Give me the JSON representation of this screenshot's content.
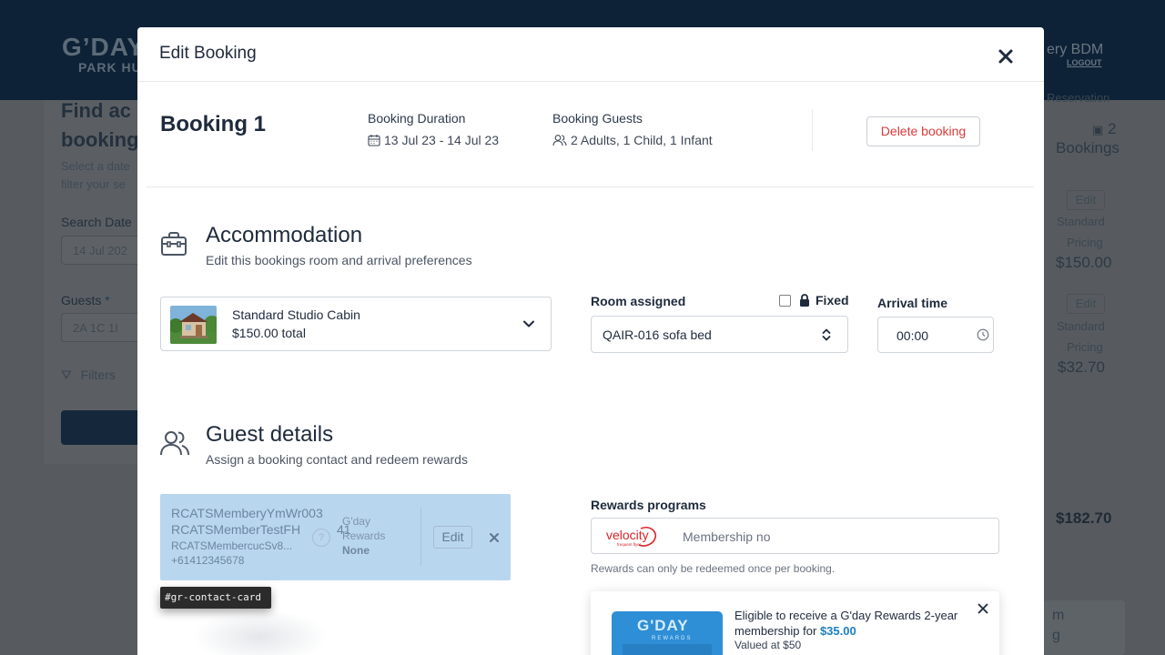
{
  "background": {
    "logo_line1": "G’DAY",
    "logo_line2": "PARK HU",
    "user_name": "ery BDM",
    "logout": "LOGOUT",
    "heading": "Find ac\nbooking",
    "sub": "Select a date\nfilter your se",
    "search_dates_label": "Search Date",
    "search_dates_value": "14 Jul 202",
    "guests_label": "Guests",
    "guests_required": "*",
    "guests_value": "2A 1C 1I",
    "filters_label": "Filters",
    "reservation_label": "Reservation",
    "bookings_count": "2",
    "bookings_label": "Bookings",
    "edit_label": "Edit",
    "standard": "Standard",
    "pricing": "Pricing",
    "price1": "$150.00",
    "price2": "$32.70",
    "total": "$182.70",
    "card_m": "m",
    "card_g": "g"
  },
  "modal": {
    "title": "Edit Booking",
    "booking_title": "Booking 1",
    "duration_label": "Booking Duration",
    "duration_value": "13 Jul 23 - 14 Jul 23",
    "guests_label": "Booking Guests",
    "guests_value": "2 Adults, 1 Child, 1 Infant",
    "delete_label": "Delete booking"
  },
  "accommodation": {
    "title": "Accommodation",
    "subtitle": "Edit this bookings room and arrival preferences",
    "room_name": "Standard Studio Cabin",
    "room_price": "$150.00 total",
    "room_assigned_label": "Room assigned",
    "fixed_label": "Fixed",
    "room_assigned_value": "QAIR-016 sofa bed",
    "arrival_label": "Arrival time",
    "arrival_value": "00:00"
  },
  "guest_details": {
    "title": "Guest details",
    "subtitle": "Assign a booking contact and redeem rewards",
    "contact_name1": "RCATSMemberyYmWr003",
    "contact_name2": "RCATSMemberTestFH",
    "contact_name2_tail": "41",
    "contact_email": "RCATSMembercucSv8...",
    "contact_phone": "+61412345678",
    "rewards_line1": "G'day",
    "rewards_line2": "Rewards",
    "rewards_value": "None",
    "help_glyph": "?",
    "edit_label": "Edit",
    "tag_label": "#gr-contact-card",
    "rewards_programs_label": "Rewards programs",
    "velocity_logo_text": "velocity",
    "velocity_logo_sub": "frequent flyer",
    "membership_placeholder": "Membership no",
    "rewards_note": "Rewards can only be redeemed once per booking.",
    "promo_text": "Eligible to receive a G'day Rewards 2-year membership for",
    "promo_price": "$35.00",
    "promo_valued": "Valued at $50",
    "promo_card_title": "G'DAY",
    "promo_card_sub": "REWARDS"
  },
  "colors": {
    "header_dark": "#0d2236",
    "delete_red": "#d93a3a",
    "contact_bg": "#b9d6ef",
    "link_blue": "#1b7fc4",
    "velocity_red": "#d9252b",
    "promo_card_blue": "#2e8ed6"
  }
}
